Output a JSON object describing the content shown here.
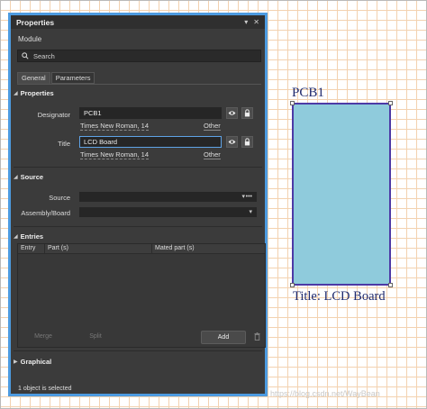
{
  "panel": {
    "title": "Properties",
    "titlebar_buttons": {
      "menu_icon": "dropdown-triangle",
      "close_icon": "close-x"
    },
    "module_label": "Module",
    "search_placeholder": "Search",
    "tabs": [
      {
        "label": "General",
        "active": true
      },
      {
        "label": "Parameters",
        "active": false
      }
    ]
  },
  "properties": {
    "header": "Properties",
    "designator_label": "Designator",
    "designator_value": "PCB1",
    "designator_font": "Times New Roman, 14",
    "designator_other": "Other",
    "title_label": "Title",
    "title_value": "LCD Board",
    "title_font": "Times New Roman, 14",
    "title_other": "Other"
  },
  "source": {
    "header": "Source",
    "source_label": "Source",
    "source_value": "",
    "assembly_label": "Assembly/Board",
    "assembly_value": ""
  },
  "entries": {
    "header": "Entries",
    "columns": [
      "Entry",
      "Part (s)",
      "Mated part (s)"
    ],
    "rows": [],
    "merge_label": "Merge",
    "split_label": "Split",
    "add_label": "Add"
  },
  "graphical": {
    "header": "Graphical"
  },
  "status": "1 object is selected",
  "canvas": {
    "designator_text": "PCB1",
    "title_text": "Title: LCD Board",
    "board_fill": "#8fcbdc",
    "board_outline": "#4c3aa6",
    "grid_color": "#f3d2b0"
  },
  "watermark": "https://blog.csdn.net/WayBean"
}
